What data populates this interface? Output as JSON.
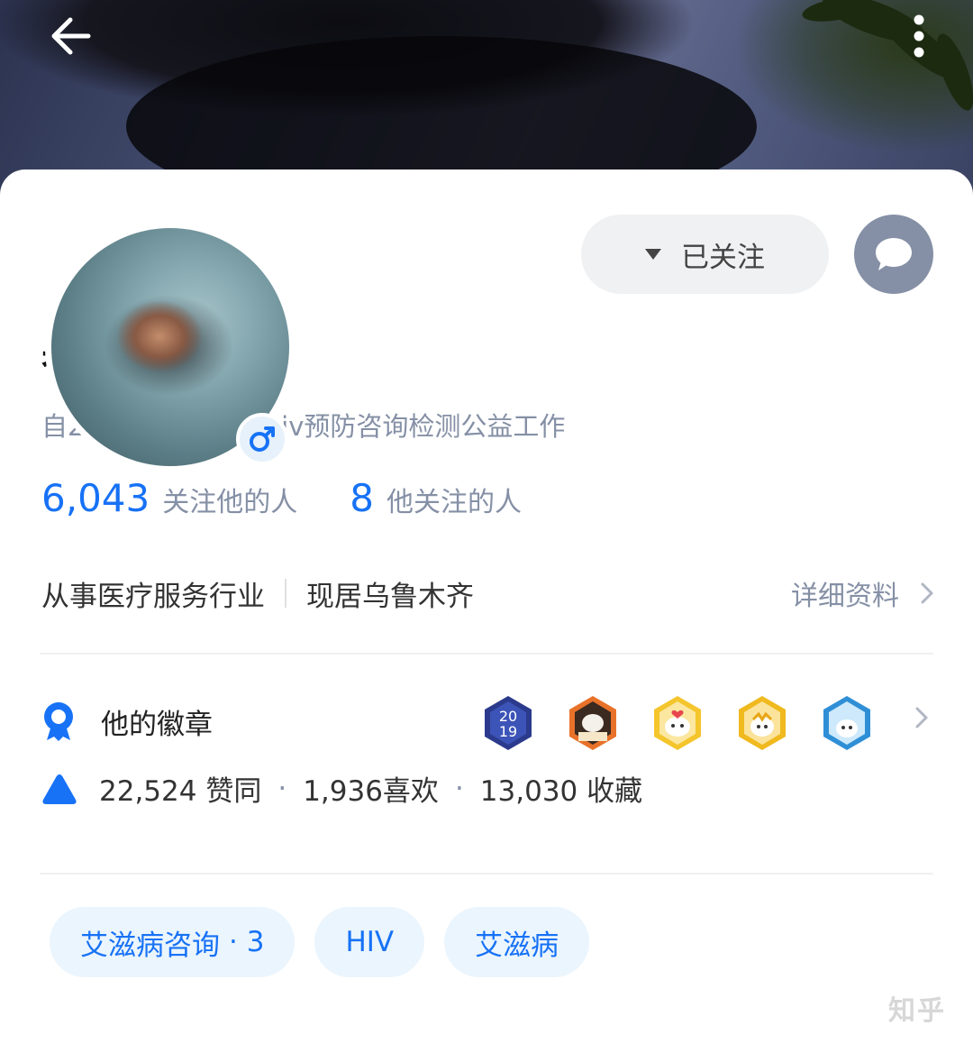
{
  "header": {
    "back_icon": "arrow-left-icon",
    "more_icon": "more-vertical-icon"
  },
  "profile": {
    "name": "者也",
    "gender_icon": "male-icon",
    "bio": "自2007年至今从事hiv预防咨询检测公益工作",
    "follow_button": {
      "icon": "caret-down-icon",
      "label": "已关注"
    },
    "message_icon": "chat-bubble-icon"
  },
  "stats": {
    "followers_count": "6,043",
    "followers_label": "关注他的人",
    "following_count": "8",
    "following_label": "他关注的人"
  },
  "info": {
    "industry": "从事医疗服务行业",
    "location": "现居乌鲁木齐",
    "detail_label": "详细资料"
  },
  "badges": {
    "icon": "medal-icon",
    "title": "他的徽章",
    "items": [
      "2019-badge",
      "reading-badge",
      "heart-badge",
      "gold-badge",
      "hexagon-badge"
    ]
  },
  "achievements": {
    "icon": "triangle-up-icon",
    "upvotes": "22,524 赞同",
    "likes": "1,936喜欢",
    "favorites": "13,030 收藏",
    "separator": "·"
  },
  "tags": [
    {
      "label": "艾滋病咨询",
      "count": "· 3"
    },
    {
      "label": "HIV"
    },
    {
      "label": "艾滋病"
    }
  ],
  "watermark": "知乎",
  "colors": {
    "accent": "#1772f6",
    "secondary_text": "#8590a6",
    "tag_bg": "#ebf5fd"
  }
}
